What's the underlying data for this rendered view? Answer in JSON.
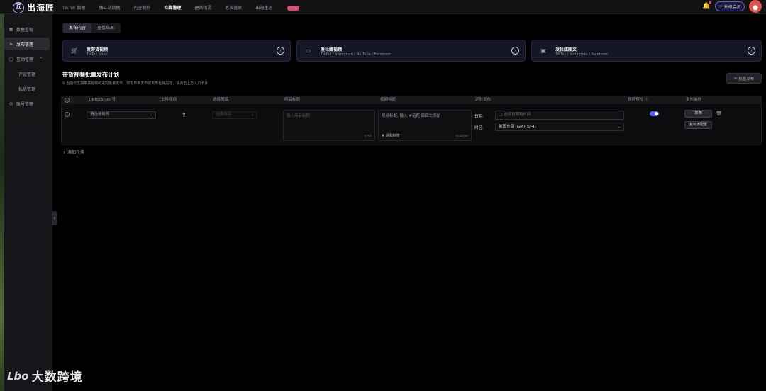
{
  "app": {
    "logo_mark": "匠",
    "logo_text": "出海匠"
  },
  "nav": {
    "items": [
      {
        "label": "TikTok 数据"
      },
      {
        "label": "独立站数据"
      },
      {
        "label": "内容制作"
      },
      {
        "label": "社媒管理",
        "active": true
      },
      {
        "label": "建站精灵"
      },
      {
        "label": "客资管家"
      },
      {
        "label": "出海生态",
        "badge": "new"
      }
    ]
  },
  "header": {
    "upgrade_label": "升级会员",
    "notification_icon": "bell-icon"
  },
  "sidebar": {
    "items": [
      {
        "label": "数据看板",
        "icon": "dashboard-icon"
      },
      {
        "label": "发布管理",
        "icon": "send-icon",
        "active": true
      },
      {
        "label": "互动管理",
        "icon": "chat-icon",
        "expand": "⌃"
      },
      {
        "label": "评论管理",
        "sub": true
      },
      {
        "label": "私信管理",
        "sub": true
      },
      {
        "label": "账号管理",
        "icon": "account-icon"
      }
    ]
  },
  "tabs": [
    {
      "label": "发布内容",
      "active": true
    },
    {
      "label": "查看结果"
    }
  ],
  "cards": [
    {
      "title": "发带货视频",
      "subtitle": "TikTok Shop",
      "icon": "cart-icon"
    },
    {
      "title": "发社媒视频",
      "subtitle": "TikTok / Instagram / YouTube / Facebook",
      "icon": "video-icon"
    },
    {
      "title": "发社媒图文",
      "subtitle": "TikTok / Instagram / Facebook",
      "icon": "image-icon"
    }
  ],
  "section": {
    "title": "带货视频批量发布计划",
    "tip": "当前仅支持带货视频的定时批量发布。如需单条发布或发布社媒内容，请点击上方入口卡片",
    "batch_label": "批量发布"
  },
  "table": {
    "headers": [
      "TikTokShop 号",
      "上传视频",
      "选择商品",
      "商品标题",
      "视频标题",
      "定时发布",
      "视频预检",
      "发布操作"
    ],
    "row": {
      "account_placeholder": "请选择账号",
      "product_placeholder": "选择商品",
      "product_title_placeholder": "输入商品标题",
      "product_title_count": "0/30",
      "video_title_placeholder": "视频标题, 输入 #话题 后回车添加",
      "topic_label": "话题标签",
      "video_title_count": "0/4000",
      "date_label": "日期:",
      "date_placeholder": "选择日期和时间",
      "timezone_label": "时区:",
      "timezone_value": "美国东部 (GMT-5/-4)",
      "precheck_on": true,
      "publish_label": "发布",
      "copy_label": "复制该配置"
    }
  },
  "add_task_label": "添加任务",
  "watermark": {
    "logo": "Lbo",
    "text": "大数跨境"
  }
}
